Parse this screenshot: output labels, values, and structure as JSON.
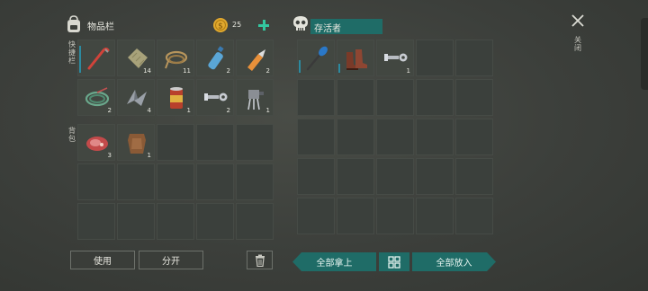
{
  "inventory": {
    "title": "物品栏",
    "coins": "25",
    "hotbar_label": "快捷栏",
    "backpack_label": "背包",
    "hotbar": [
      {
        "icon": "crowbar-icon",
        "count": ""
      },
      {
        "icon": "cloth-icon",
        "count": "14"
      },
      {
        "icon": "rope-icon",
        "count": "11"
      },
      {
        "icon": "water-bottle-icon",
        "count": "2"
      },
      {
        "icon": "glue-icon",
        "count": "2"
      },
      {
        "icon": "wire-coil-icon",
        "count": "2"
      },
      {
        "icon": "metal-scrap-icon",
        "count": "4"
      },
      {
        "icon": "canned-food-icon",
        "count": "1"
      },
      {
        "icon": "bolt-nut-icon",
        "count": "2"
      },
      {
        "icon": "electronic-parts-icon",
        "count": "1"
      }
    ],
    "backpack": [
      {
        "icon": "raw-meat-icon",
        "count": "3"
      },
      {
        "icon": "leather-hide-icon",
        "count": "1"
      }
    ]
  },
  "container": {
    "title": "存活者",
    "items": [
      {
        "icon": "paddle-icon",
        "count": ""
      },
      {
        "icon": "boots-icon",
        "count": ""
      },
      {
        "icon": "bolt-nut-icon",
        "count": "1"
      }
    ]
  },
  "close_label": "关闭",
  "buttons": {
    "use": "使用",
    "split": "分开",
    "take_all": "全部拿上",
    "put_all": "全部放入"
  },
  "colors": {
    "accent": "#1f6c67",
    "plus": "#33c7a0",
    "coin": "#e0a82e"
  }
}
